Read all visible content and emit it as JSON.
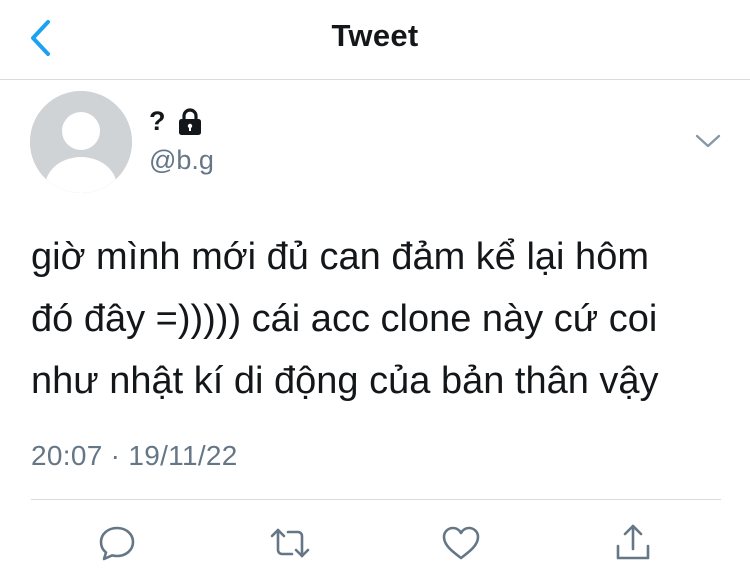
{
  "header": {
    "title": "Tweet",
    "back_icon": "chevron-left-icon"
  },
  "author": {
    "name": "?",
    "handle": "@b.g",
    "protected_icon": "lock-icon",
    "avatar_icon": "default-avatar-icon"
  },
  "tweet": {
    "text": "giờ mình mới đủ can đảm kể lại hôm\nđó đây =))))) cái acc clone này cứ coi\nnhư nhật kí di động của bản thân vậy",
    "timestamp": "20:07 · 19/11/22"
  },
  "actions": {
    "reply_icon": "reply-icon",
    "retweet_icon": "retweet-icon",
    "like_icon": "heart-icon",
    "share_icon": "share-icon"
  },
  "colors": {
    "accent": "#1da1f2",
    "secondary_text": "#657786",
    "divider": "#d7dce0",
    "avatar_bg": "#d0d3d6"
  }
}
